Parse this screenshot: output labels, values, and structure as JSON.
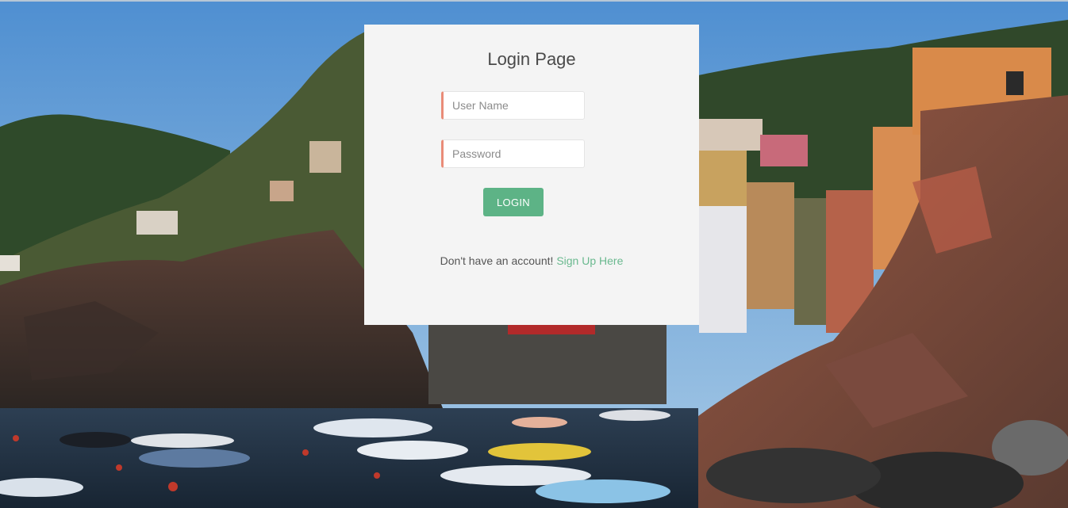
{
  "page": {
    "title": "Login Page"
  },
  "form": {
    "username_placeholder": "User Name",
    "password_placeholder": "Password",
    "login_label": "LOGIN"
  },
  "signup": {
    "prompt": "Don't have an account!",
    "link_label": "Sign Up Here"
  },
  "colors": {
    "card_background": "#f4f4f4",
    "button_green": "#5db386",
    "link_green": "#6ab98f",
    "field_accent": "#e98c78"
  }
}
